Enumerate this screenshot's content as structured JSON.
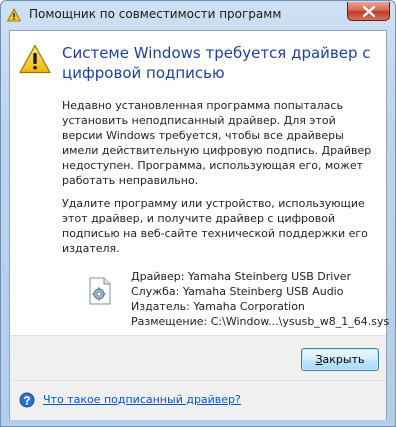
{
  "window": {
    "title": "Помощник по совместимости программ",
    "close_icon": "close-icon"
  },
  "main": {
    "heading": "Системе Windows требуется драйвер с цифровой подписью",
    "paragraph1": "Недавно установленная программа попыталась установить неподписанный драйвер. Для этой версии Windows требуется, чтобы все драйверы имели действительную цифровую подпись. Драйвер недоступен. Программа, использующая его, может работать неправильно.",
    "paragraph2": "Удалите программу или устройство, использующие этот драйвер, и получите драйвер с цифровой подписью на веб-сайте технической поддержки его издателя."
  },
  "details": {
    "driver": "Драйвер: Yamaha Steinberg USB Driver",
    "service": "Служба: Yamaha Steinberg USB Audio",
    "publisher": "Издатель: Yamaha Corporation",
    "location": "Размещение: C:\\Window...\\ysusb_w8_1_64.sys"
  },
  "buttons": {
    "close_label_accel": "З",
    "close_label_rest": "акрыть"
  },
  "footer": {
    "help_link": "Что такое подписанный драйвер?"
  },
  "colors": {
    "heading": "#1f3f9c",
    "link": "#0055cc",
    "warning": "#f5c518"
  }
}
